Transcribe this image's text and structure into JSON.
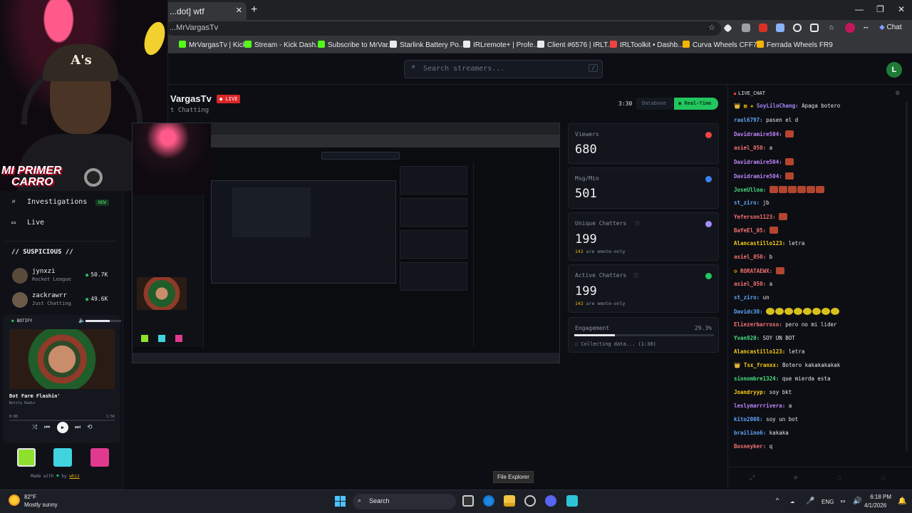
{
  "browser": {
    "tab_title": "...dot] wtf",
    "url": "...MrVargasTv",
    "bookmarks": [
      {
        "label": "MrVargasTv | Kick",
        "color": "#53fc18"
      },
      {
        "label": "Stream - Kick Dash...",
        "color": "#53fc18"
      },
      {
        "label": "Subscribe to MrVar...",
        "color": "#53fc18"
      },
      {
        "label": "Starlink Battery Po...",
        "color": "#e8eaed"
      },
      {
        "label": "IRLremote+ | Profe...",
        "color": "#e8eaed"
      },
      {
        "label": "Client #6576 | IRLT...",
        "color": "#e8eaed"
      },
      {
        "label": "IRLToolkit • Dashb...",
        "color": "#ef4444"
      },
      {
        "label": "Curva Wheels CFF76",
        "color": "#f4b400"
      },
      {
        "label": "Ferrada Wheels FR9",
        "color": "#f4b400"
      }
    ],
    "chat_button": "Chat"
  },
  "site": {
    "search_placeholder": "Search streamers...",
    "search_key": "/",
    "user_initial": "L"
  },
  "webcam": {
    "overlay_text_1": "MI PRIMER",
    "overlay_text_2": "CARRO",
    "cap_logo": "A's"
  },
  "sidebar": {
    "nav": [
      {
        "label": "Investigations",
        "badge": "NEW"
      },
      {
        "label": "Live"
      }
    ],
    "suspicious_title": "// SUSPICIOUS //",
    "suspicious": [
      {
        "name": "jynxzi",
        "sub": "Rocket League",
        "count": "50.7K"
      },
      {
        "name": "zackrawrr",
        "sub": "Just Chatting",
        "count": "49.6K"
      }
    ],
    "player": {
      "title": "BOTIFY",
      "song": "Bot Farm Flashin'",
      "artist": "Botify Radio",
      "time_current": "0:00",
      "time_total": "1:56"
    },
    "swatches": [
      "#8ee02c",
      "#40d4e0",
      "#e03a8f"
    ],
    "made_with_prefix": "Made with",
    "made_with_heart": "♥",
    "made_with_by": "by",
    "made_with_author": "whiz"
  },
  "channel": {
    "name": "VargasTv",
    "live": "LIVE",
    "category": "t Chatting",
    "timer": "3:30",
    "tab_database": "Database",
    "tab_realtime": "Real-Time"
  },
  "stats": [
    {
      "label": "Viewers",
      "value": "680",
      "sub_num": "",
      "sub": "",
      "color": "#ef4444"
    },
    {
      "label": "Msg/Min",
      "value": "501",
      "sub_num": "",
      "sub": "",
      "color": "#3b82f6"
    },
    {
      "label": "Unique Chatters",
      "value": "199",
      "sub_num": "142",
      "sub": "are emote-only",
      "color": "#a78bfa"
    },
    {
      "label": "Active Chatters",
      "value": "199",
      "sub_num": "142",
      "sub": "are emote-only",
      "color": "#22c55e"
    }
  ],
  "engagement": {
    "label": "Engagement",
    "percent": "29.3%",
    "status": "Collecting data... (1:30)",
    "fill": 0.293
  },
  "chat": {
    "header": "LIVE_CHAT",
    "messages": [
      {
        "user": "SoyLiloChang:",
        "text": "Apaga botero",
        "color": "#a78bfa",
        "prefix": "👑 ▦ ✚ "
      },
      {
        "user": "raul6797:",
        "text": "pasen el d",
        "color": "#60a5fa"
      },
      {
        "user": "Davidramire504:",
        "text": "",
        "color": "#c084fc",
        "emotes": 1
      },
      {
        "user": "asiel_050:",
        "text": "a",
        "color": "#f87171"
      },
      {
        "user": "Davidramire504:",
        "text": "",
        "color": "#c084fc",
        "emotes": 1
      },
      {
        "user": "Davidramire504:",
        "text": "",
        "color": "#c084fc",
        "emotes": 1
      },
      {
        "user": "JoseUlloa:",
        "text": "",
        "color": "#4ade80",
        "emotes": 6
      },
      {
        "user": "st_ziro:",
        "text": "jb",
        "color": "#60a5fa"
      },
      {
        "user": "Yeferson1123:",
        "text": "",
        "color": "#f87171",
        "emotes": 1
      },
      {
        "user": "BaYeEl_05:",
        "text": "",
        "color": "#f87171",
        "emotes": 1
      },
      {
        "user": "Alancastillo123:",
        "text": "letra",
        "color": "#facc15"
      },
      {
        "user": "asiel_050:",
        "text": "b",
        "color": "#f87171"
      },
      {
        "user": "RORATAEWX:",
        "text": "",
        "color": "#f87171",
        "emotes": 1,
        "prefix": "⚙ "
      },
      {
        "user": "asiel_050:",
        "text": "a",
        "color": "#f87171"
      },
      {
        "user": "st_ziro:",
        "text": "un",
        "color": "#60a5fa"
      },
      {
        "user": "Davidc30:",
        "text": "",
        "color": "#60a5fa",
        "emotes": 8,
        "gold": true
      },
      {
        "user": "Eliezerbarroso:",
        "text": "pero no mi lider",
        "color": "#f87171"
      },
      {
        "user": "Yvan920:",
        "text": "SOY UN BOT",
        "color": "#4ade80"
      },
      {
        "user": "Alancastillo123:",
        "text": "letra",
        "color": "#facc15"
      },
      {
        "user": "Tsx_franxx:",
        "text": "Botero kakakakakak",
        "color": "#facc15",
        "prefix": "👑 "
      },
      {
        "user": "sinnombre1324:",
        "text": "que mierda esta",
        "color": "#4ade80"
      },
      {
        "user": "Joandryyp:",
        "text": "soy  bkt",
        "color": "#facc15"
      },
      {
        "user": "leslymarrrivera:",
        "text": "a",
        "color": "#c084fc"
      },
      {
        "user": "kito2008:",
        "text": "soy un bot",
        "color": "#60a5fa"
      },
      {
        "user": "brailino6:",
        "text": "kakaka",
        "color": "#60a5fa"
      },
      {
        "user": "Bosneyker:",
        "text": "q",
        "color": "#f87171"
      }
    ]
  },
  "tooltip": "File Explorer",
  "taskbar": {
    "temp": "82°F",
    "weather": "Mostly sunny",
    "search": "Search",
    "lang": "ENG",
    "time": "6:18 PM",
    "date": "4/1/2026"
  }
}
